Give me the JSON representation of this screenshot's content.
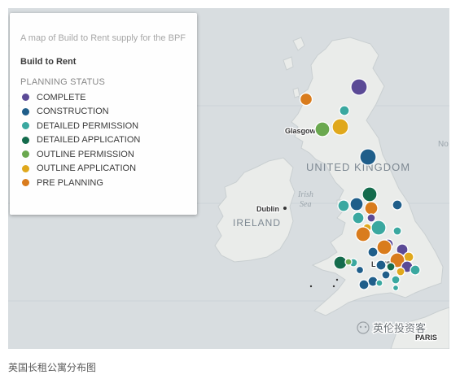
{
  "map": {
    "legend": {
      "subtitle": "A map of Build to Rent supply for the BPF",
      "title": "Build to Rent",
      "section": "PLANNING STATUS",
      "items": [
        {
          "label": "COMPLETE",
          "color": "#5b4a96"
        },
        {
          "label": "CONSTRUCTION",
          "color": "#1f5e8a"
        },
        {
          "label": "DETAILED PERMISSION",
          "color": "#3aa8a0"
        },
        {
          "label": "DETAILED APPLICATION",
          "color": "#146b4c"
        },
        {
          "label": "OUTLINE PERMISSION",
          "color": "#6aa84f"
        },
        {
          "label": "OUTLINE APPLICATION",
          "color": "#e0a81c"
        },
        {
          "label": "PRE PLANNING",
          "color": "#d97c1d"
        }
      ]
    },
    "labels": {
      "country_uk": "UNITED KINGDOM",
      "country_ireland": "IRELAND",
      "sea": [
        "Irish",
        "Sea"
      ],
      "north_sea": "No",
      "city_glasgow": "Glasgow",
      "city_dublin": "Dublin",
      "city_london": "LONDON",
      "city_paris": "PARIS"
    },
    "watermark": "英伦投资客"
  },
  "caption": "英国长租公寓分布图"
}
